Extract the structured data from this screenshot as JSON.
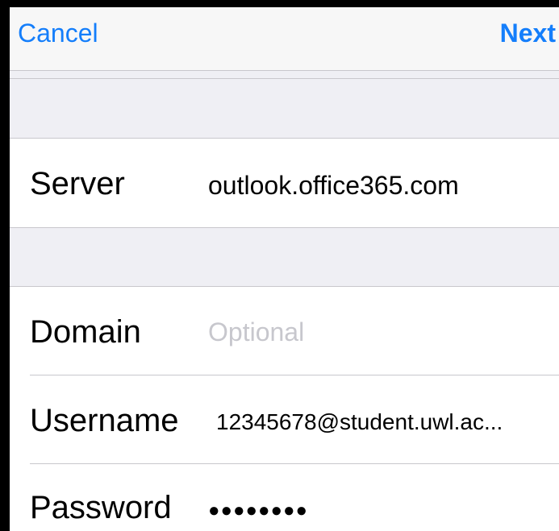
{
  "navbar": {
    "cancel_label": "Cancel",
    "next_label": "Next"
  },
  "server_group": {
    "server_label": "Server",
    "server_value": "outlook.office365.com"
  },
  "account_group": {
    "domain_label": "Domain",
    "domain_placeholder": "Optional",
    "username_label": "Username",
    "username_value": "12345678@student.uwl.ac...",
    "password_label": "Password",
    "password_value": "●●●●●●●●"
  },
  "colors": {
    "accent": "#147efb",
    "background": "#efeff4",
    "separator": "#c8c7cc",
    "placeholder": "#c7c7cd"
  }
}
